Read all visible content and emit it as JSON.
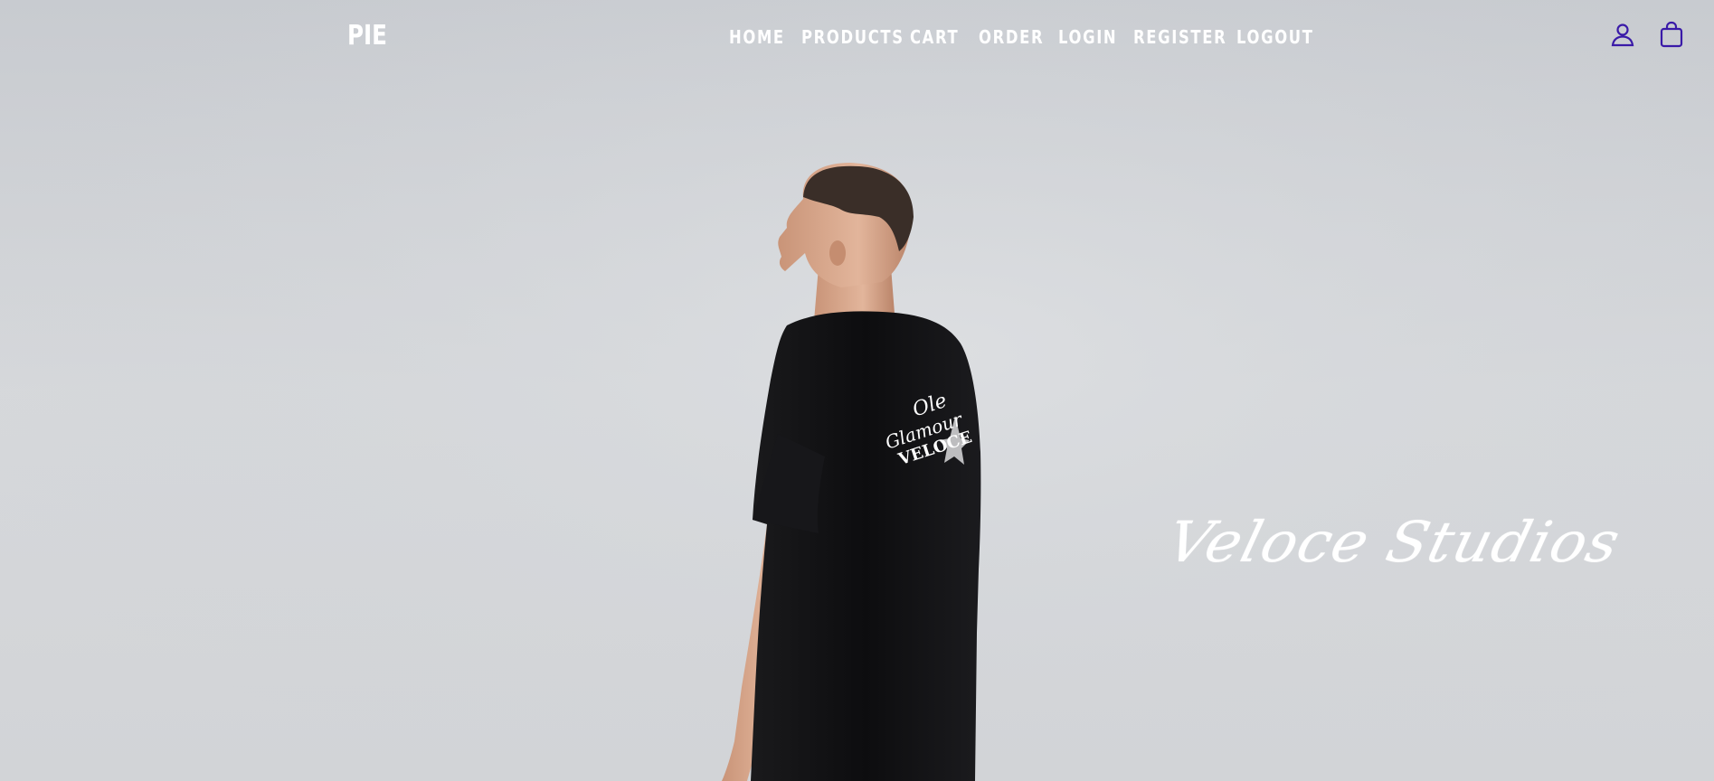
{
  "brand": {
    "logo": "PIE",
    "script_title": "Veloce Studios"
  },
  "nav": {
    "items": [
      {
        "label": "HOME"
      },
      {
        "label": "PRODUCTS"
      },
      {
        "label": "CART"
      },
      {
        "label": "ORDER"
      },
      {
        "label": "LOGIN"
      },
      {
        "label": "REGISTER"
      },
      {
        "label": "LOGOUT"
      }
    ]
  },
  "icons": {
    "account": "user-icon",
    "cart": "shopping-bag-icon"
  },
  "hero": {
    "image": "model-black-tshirt-back-view",
    "shirt_print_lines": [
      "Ole",
      "Glamour",
      "VELOCE"
    ]
  },
  "colors": {
    "background": "#cfd2d6",
    "nav_text": "#ffffff",
    "icon_accent": "#3a1aa8",
    "shirt": "#121214"
  }
}
